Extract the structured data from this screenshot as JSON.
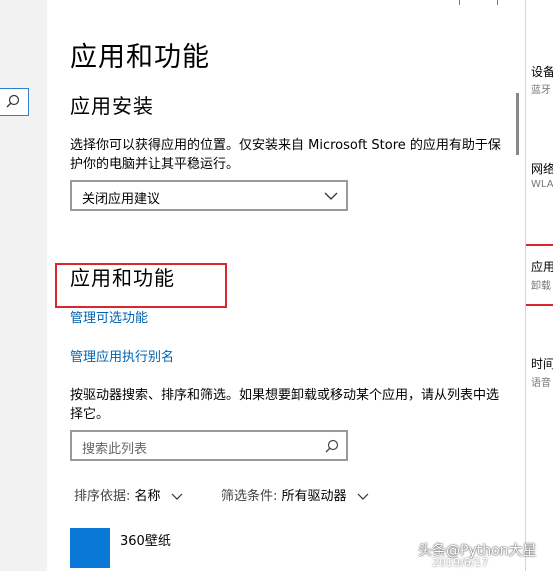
{
  "page": {
    "title": "应用和功能",
    "install_section": {
      "heading": "应用安装",
      "description": "选择你可以获得应用的位置。仅安装来自 Microsoft Store 的应用有助于保护你的电脑并让其平稳运行。",
      "dropdown_value": "关闭应用建议"
    },
    "apps_section": {
      "heading": "应用和功能",
      "link_manage_optional": "管理可选功能",
      "link_manage_alias": "管理应用执行别名",
      "description": "按驱动器搜索、排序和筛选。如果想要卸载或移动某个应用，请从列表中选择它。",
      "search_placeholder": "搜索此列表",
      "sort_label": "排序依据:",
      "sort_value": "名称",
      "filter_label": "筛选条件:",
      "filter_value": "所有驱动器"
    },
    "apps": [
      {
        "name": "360壁纸",
        "tile_color": "#0a78d7"
      }
    ]
  },
  "right_nav": {
    "items": [
      {
        "label": "设备",
        "sub": "蓝牙"
      },
      {
        "label": "网络",
        "sub": "WLA"
      },
      {
        "label": "应用",
        "sub": "卸载"
      },
      {
        "label": "时间",
        "sub": "语音"
      }
    ]
  },
  "watermark": {
    "line1": "头条@Python大星",
    "line2": "2019/6/17"
  },
  "colors": {
    "link": "#0063b1",
    "highlight": "#d7282f",
    "search_border_accent": "#2f7fd6"
  }
}
